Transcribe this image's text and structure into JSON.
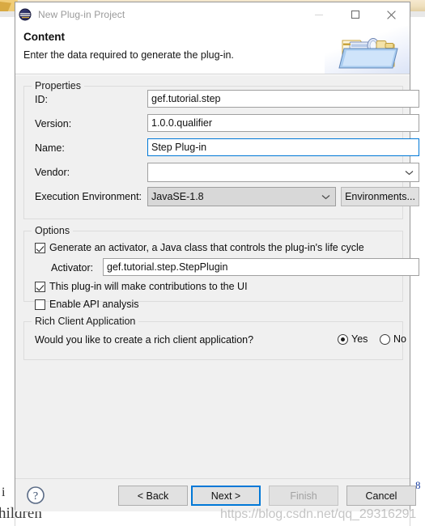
{
  "window": {
    "title": "New Plug-in Project",
    "app_icon": "eclipse-icon",
    "minimize_label": "Minimize",
    "maximize_label": "Maximize",
    "close_label": "Close"
  },
  "header": {
    "title": "Content",
    "description": "Enter the data required to generate the plug-in.",
    "banner_icon": "plugin-folder-icon"
  },
  "properties": {
    "group_label": "Properties",
    "id_label": "ID:",
    "id_value": "gef.tutorial.step",
    "version_label": "Version:",
    "version_value": "1.0.0.qualifier",
    "name_label": "Name:",
    "name_value": "Step Plug-in",
    "vendor_label": "Vendor:",
    "vendor_value": "",
    "ee_label": "Execution Environment:",
    "ee_value": "JavaSE-1.8",
    "environments_button": "Environments..."
  },
  "options": {
    "group_label": "Options",
    "activator_checkbox": "Generate an activator, a Java class that controls the plug-in's life cycle",
    "activator_checked": true,
    "activator_label": "Activator:",
    "activator_value": "gef.tutorial.step.StepPlugin",
    "ui_contributions_checkbox": "This plug-in will make contributions to the UI",
    "ui_contributions_checked": true,
    "api_analysis_checkbox": "Enable API analysis",
    "api_analysis_checked": false
  },
  "rich_client": {
    "group_label": "Rich Client Application",
    "question": "Would you like to create a rich client application?",
    "yes_label": "Yes",
    "no_label": "No",
    "selected": "Yes"
  },
  "footer": {
    "help_icon": "help-question-icon",
    "back_button": "< Back",
    "next_button": "Next >",
    "finish_button": "Finish",
    "cancel_button": "Cancel",
    "finish_disabled": true,
    "default_button": "Next >"
  },
  "background": {
    "text_fragment_1": "i",
    "text_fragment_2": "hildren",
    "right_fragment": "8"
  },
  "watermark": {
    "text": "https://blog.csdn.net/qq_29316291"
  },
  "colors": {
    "accent": "#0078d7",
    "dialog_bg": "#f0f0f0",
    "field_bg": "#ffffff",
    "title_text": "#9a9a9a",
    "border": "#dcdcdc"
  }
}
